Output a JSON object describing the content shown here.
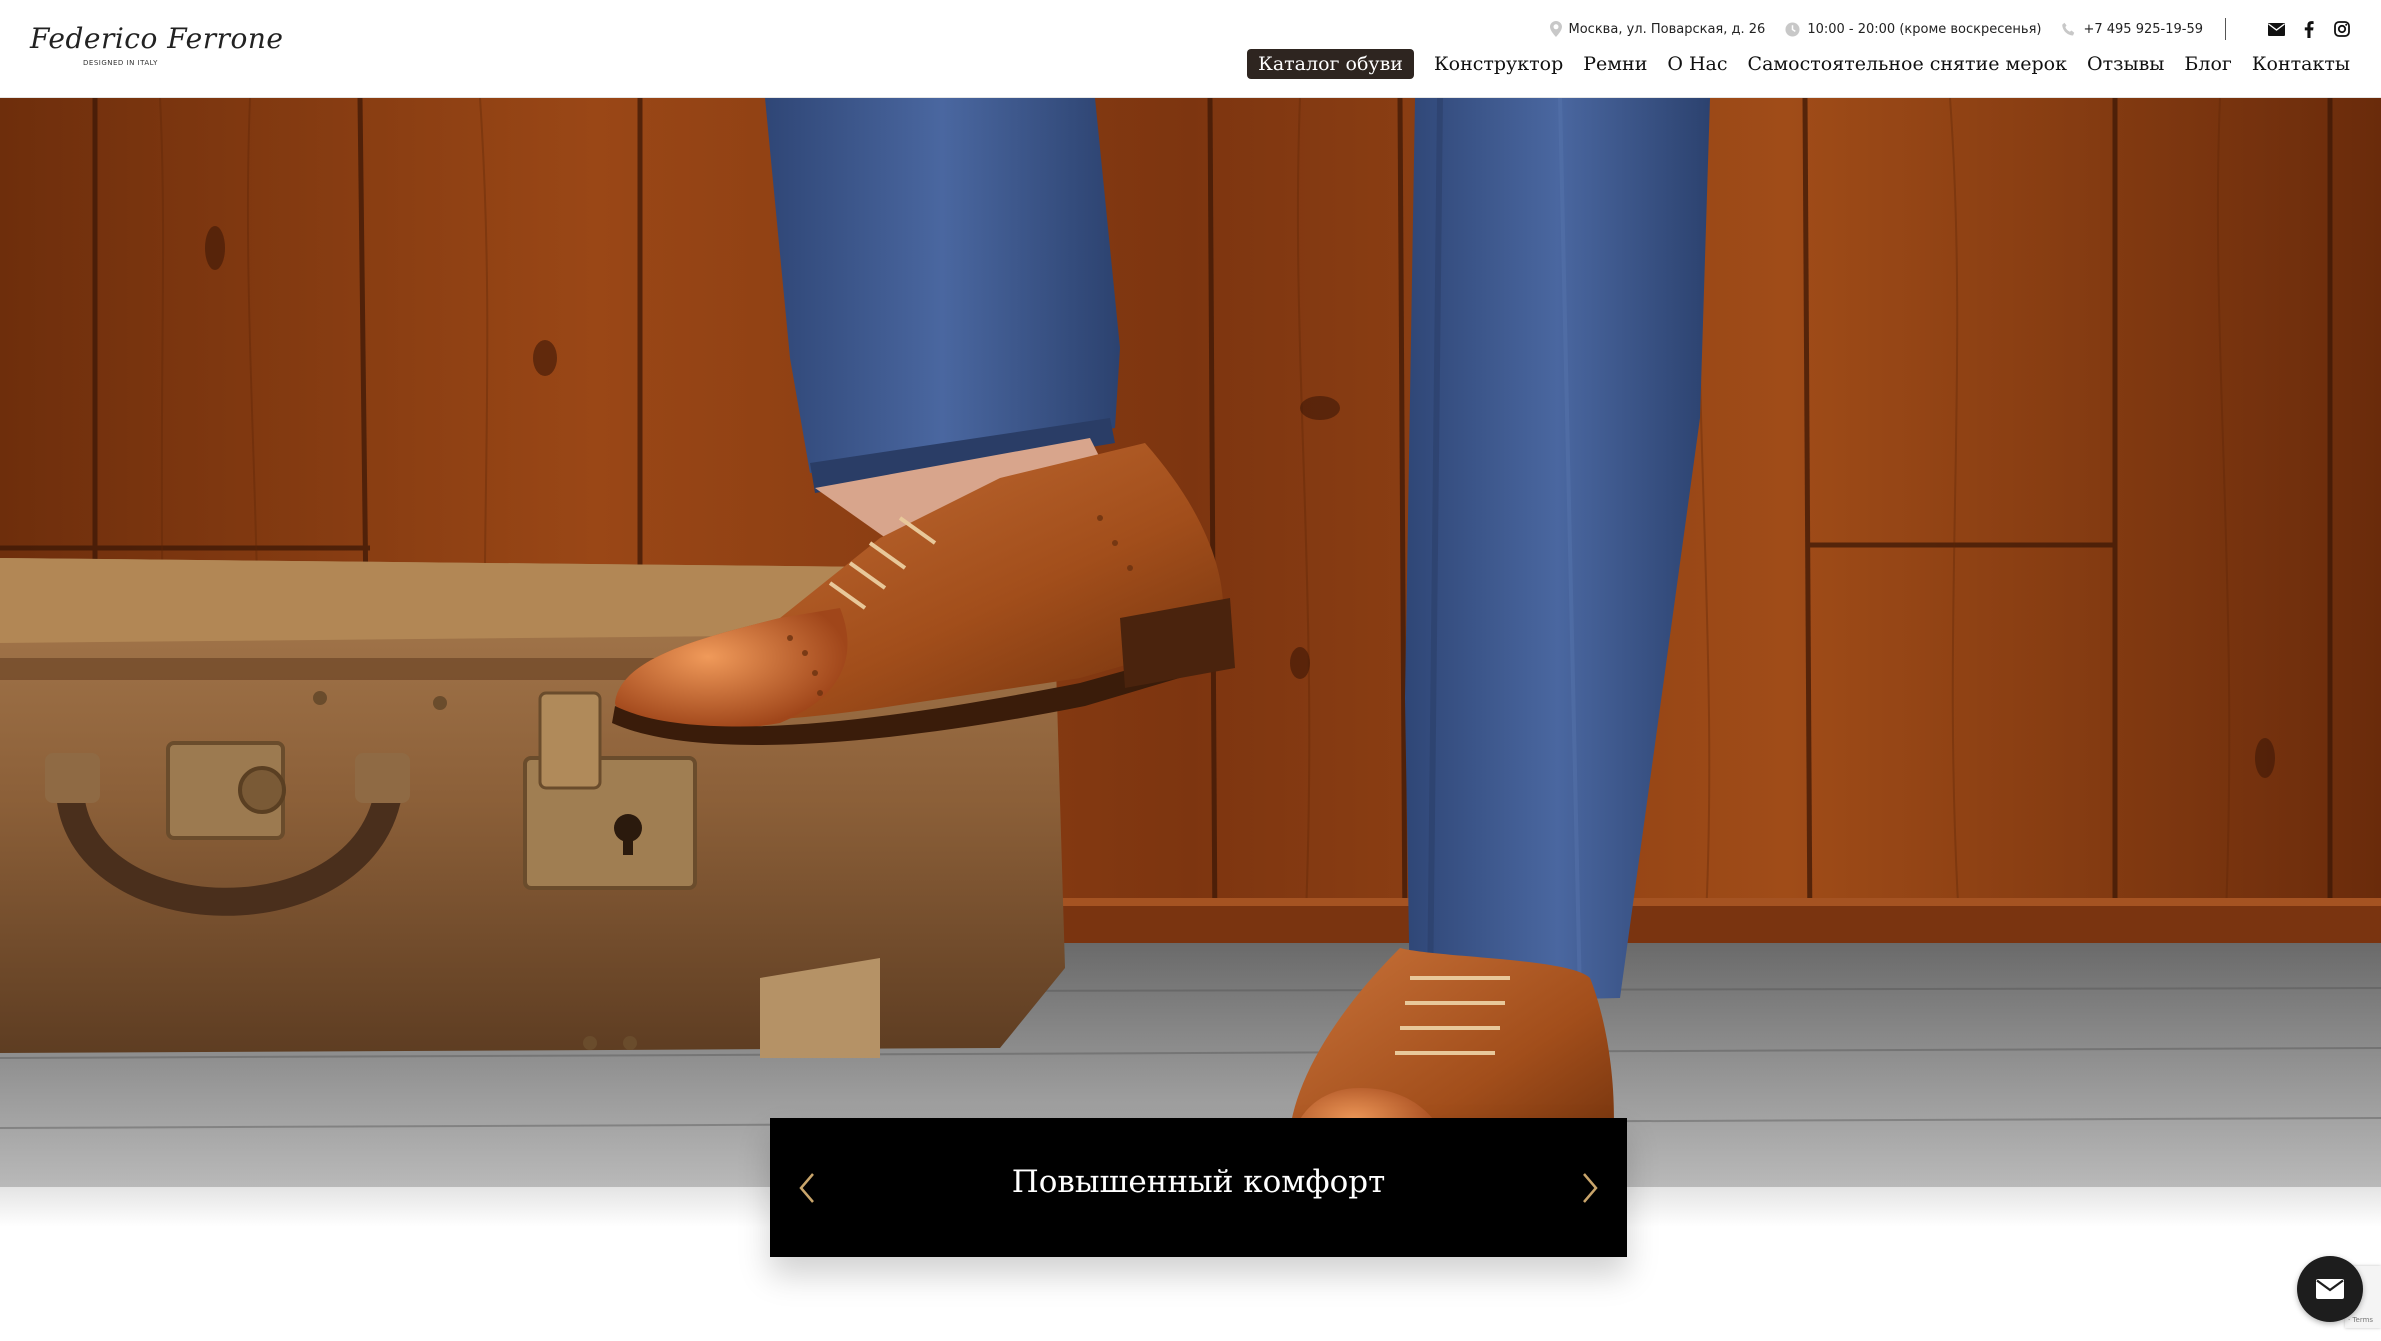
{
  "logo": {
    "script": "Federico Ferrone",
    "tagline": "DESIGNED IN ITALY"
  },
  "topbar": {
    "address": "Москва, ул. Поварская, д. 26",
    "address_icon": "map-pin-icon",
    "hours": "10:00 - 20:00 (кроме воскресенья)",
    "hours_icon": "clock-icon",
    "phone": "+7 495 925-19-59",
    "phone_icon": "phone-icon",
    "social": [
      {
        "icon": "mail-icon",
        "glyph": "✉"
      },
      {
        "icon": "facebook-icon",
        "glyph": "f"
      },
      {
        "icon": "instagram-icon",
        "glyph": "◎"
      }
    ]
  },
  "nav": {
    "items": [
      {
        "label": "Каталог обуви",
        "active": true
      },
      {
        "label": "Конструктор"
      },
      {
        "label": "Ремни"
      },
      {
        "label": "О Нас"
      },
      {
        "label": "Самостоятельное снятие мерок"
      },
      {
        "label": "Отзывы"
      },
      {
        "label": "Блог"
      },
      {
        "label": "Контакты"
      }
    ]
  },
  "slider": {
    "title": "Повышенный комфорт",
    "prev_icon": "chevron-left-icon",
    "next_icon": "chevron-right-icon",
    "arrow_color": "#c9a56b"
  },
  "chat": {
    "icon": "mail-icon"
  },
  "colors": {
    "active_nav_bg": "#2e2520",
    "caption_bg": "#000000",
    "wood": "#8a3d12",
    "trousers": "#3f5a8c",
    "shoe_leather": "#b0581e",
    "suitcase": "#8b5a30"
  }
}
